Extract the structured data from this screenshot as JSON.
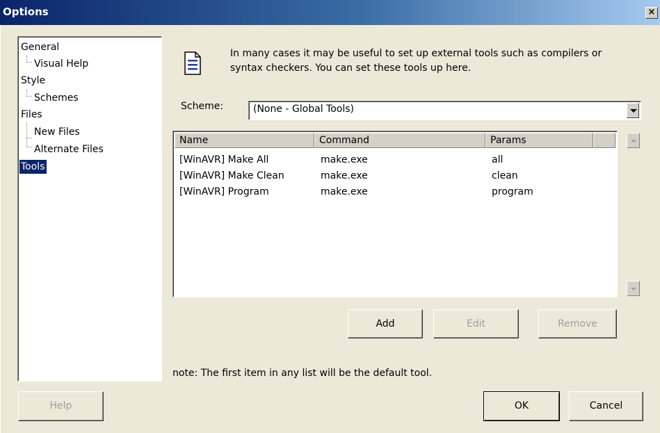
{
  "window": {
    "title": "Options",
    "close_glyph": "×"
  },
  "tree": {
    "items": [
      {
        "label": "General",
        "level": 0,
        "selected": false
      },
      {
        "label": "Visual Help",
        "level": 1,
        "selected": false
      },
      {
        "label": "Style",
        "level": 0,
        "selected": false
      },
      {
        "label": "Schemes",
        "level": 1,
        "selected": false
      },
      {
        "label": "Files",
        "level": 0,
        "selected": false
      },
      {
        "label": "New Files",
        "level": 1,
        "selected": false
      },
      {
        "label": "Alternate Files",
        "level": 1,
        "selected": false
      },
      {
        "label": "Tools",
        "level": 0,
        "selected": true
      }
    ]
  },
  "info": {
    "icon": "document-icon",
    "text": "In many cases it may be useful to set up external tools such as compilers or syntax checkers. You can set these tools up here."
  },
  "scheme": {
    "label": "Scheme:",
    "value": "(None - Global Tools)"
  },
  "tools_table": {
    "columns": [
      "Name",
      "Command",
      "Params"
    ],
    "rows": [
      [
        "[WinAVR] Make All",
        "make.exe",
        "all"
      ],
      [
        "[WinAVR] Make Clean",
        "make.exe",
        "clean"
      ],
      [
        "[WinAVR] Program",
        "make.exe",
        "program"
      ]
    ]
  },
  "buttons": {
    "add": "Add",
    "edit": "Edit",
    "remove": "Remove",
    "help": "Help",
    "ok": "OK",
    "cancel": "Cancel"
  },
  "note": "note: The first item in any list will be the default tool.",
  "colors": {
    "titlebar_start": "#0a246a",
    "selection": "#0a246a",
    "dialog_bg": "#ece9d8"
  }
}
